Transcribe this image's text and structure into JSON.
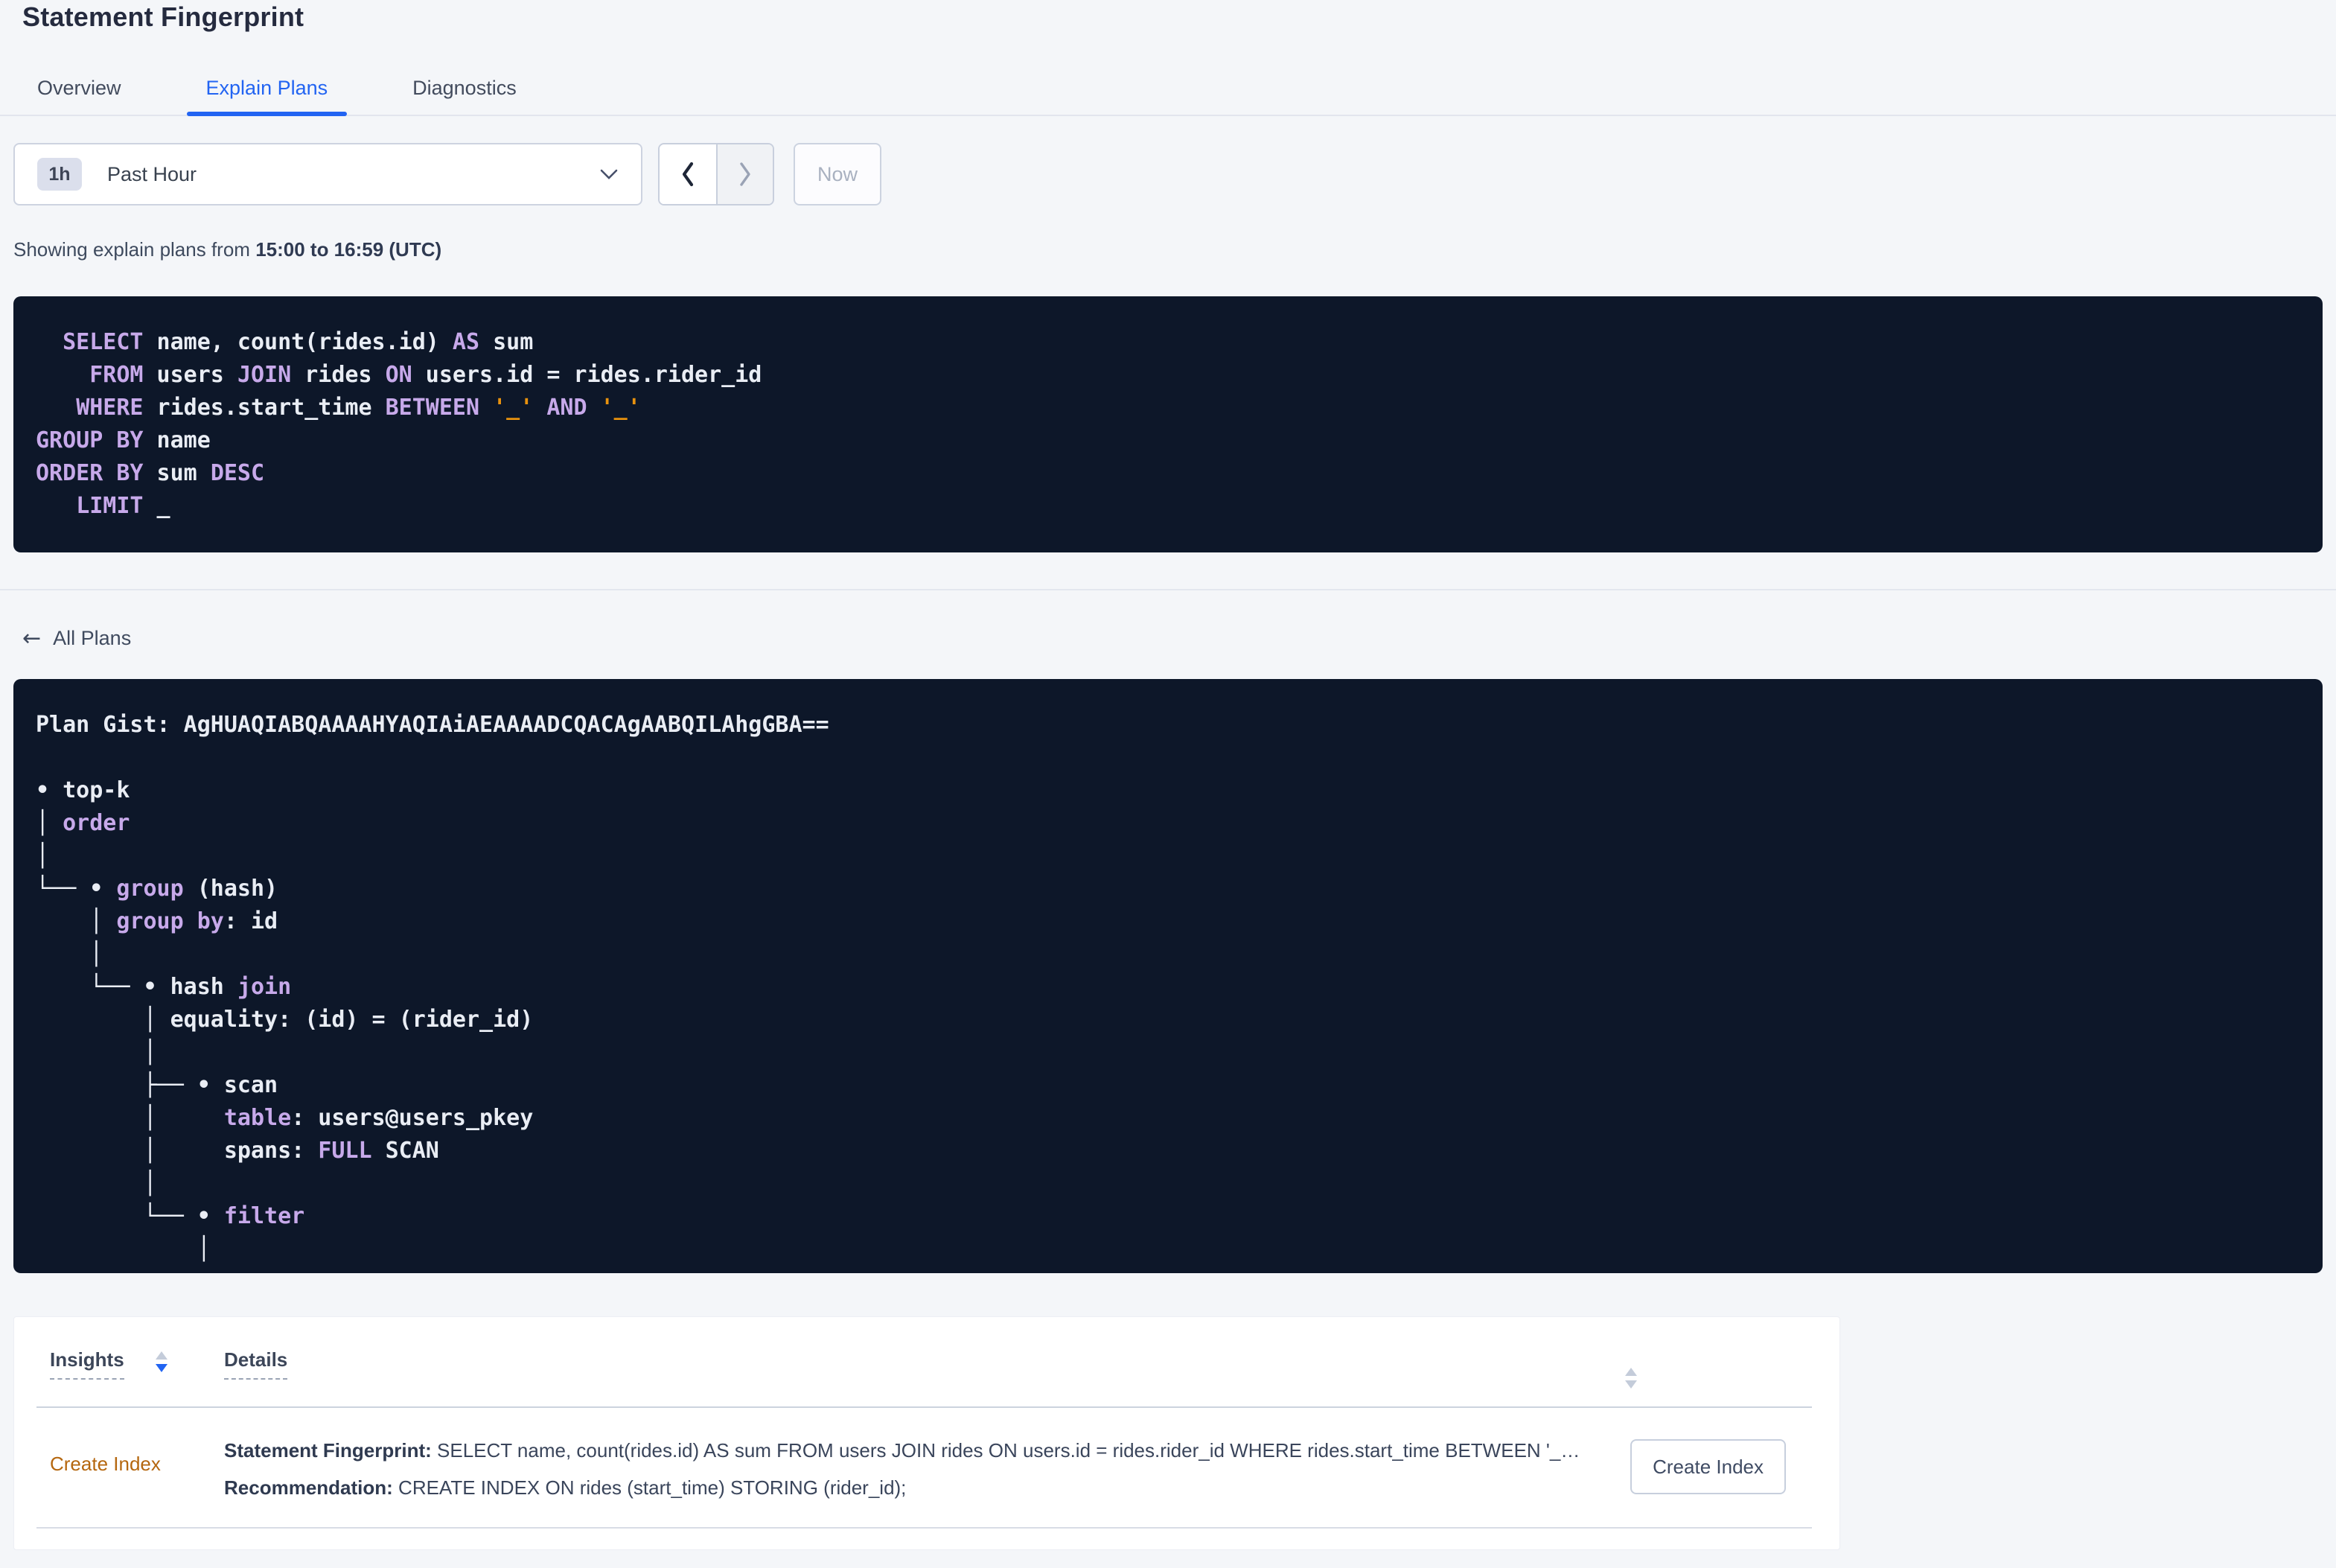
{
  "page": {
    "title": "Statement Fingerprint"
  },
  "tabs": [
    {
      "label": "Overview",
      "active": false
    },
    {
      "label": "Explain Plans",
      "active": true
    },
    {
      "label": "Diagnostics",
      "active": false
    }
  ],
  "time_picker": {
    "badge": "1h",
    "label": "Past Hour",
    "now_label": "Now"
  },
  "caption": {
    "prefix": "Showing explain plans from ",
    "range": "15:00 to 16:59 (UTC)"
  },
  "sql": {
    "lines": [
      [
        [
          "p",
          "  "
        ],
        [
          "k",
          "SELECT"
        ],
        [
          "p",
          " name, count(rides.id) "
        ],
        [
          "k",
          "AS"
        ],
        [
          "p",
          " sum"
        ]
      ],
      [
        [
          "p",
          "    "
        ],
        [
          "k",
          "FROM"
        ],
        [
          "p",
          " users "
        ],
        [
          "k",
          "JOIN"
        ],
        [
          "p",
          " rides "
        ],
        [
          "k",
          "ON"
        ],
        [
          "p",
          " users.id = rides.rider_id"
        ]
      ],
      [
        [
          "p",
          "   "
        ],
        [
          "k",
          "WHERE"
        ],
        [
          "p",
          " rides.start_time "
        ],
        [
          "k",
          "BETWEEN"
        ],
        [
          "p",
          " "
        ],
        [
          "l",
          "'_'"
        ],
        [
          "p",
          " "
        ],
        [
          "k",
          "AND"
        ],
        [
          "p",
          " "
        ],
        [
          "l",
          "'_'"
        ]
      ],
      [
        [
          "k",
          "GROUP BY"
        ],
        [
          "p",
          " name"
        ]
      ],
      [
        [
          "k",
          "ORDER BY"
        ],
        [
          "p",
          " sum "
        ],
        [
          "k",
          "DESC"
        ]
      ],
      [
        [
          "p",
          "   "
        ],
        [
          "k",
          "LIMIT"
        ],
        [
          "p",
          " _"
        ]
      ]
    ]
  },
  "back_link": {
    "arrow": "←",
    "label": "All Plans"
  },
  "plan": {
    "gist": "Plan Gist: AgHUAQIABQAAAAHYAQIAiAEAAAADCQACAgAABQILAhgGBA==",
    "tree": [
      [
        [
          "p",
          "• top-k"
        ]
      ],
      [
        [
          "p",
          "│ "
        ],
        [
          "k",
          "order"
        ]
      ],
      [
        [
          "p",
          "│"
        ]
      ],
      [
        [
          "p",
          "└── • "
        ],
        [
          "k",
          "group"
        ],
        [
          "p",
          " (hash)"
        ]
      ],
      [
        [
          "p",
          "    │ "
        ],
        [
          "k",
          "group by"
        ],
        [
          "p",
          ": id"
        ]
      ],
      [
        [
          "p",
          "    │"
        ]
      ],
      [
        [
          "p",
          "    └── • hash "
        ],
        [
          "k",
          "join"
        ]
      ],
      [
        [
          "p",
          "        │ equality: (id) = (rider_id)"
        ]
      ],
      [
        [
          "p",
          "        │"
        ]
      ],
      [
        [
          "p",
          "        ├── • scan"
        ]
      ],
      [
        [
          "p",
          "        │     "
        ],
        [
          "k",
          "table"
        ],
        [
          "p",
          ": users@users_pkey"
        ]
      ],
      [
        [
          "p",
          "        │     spans: "
        ],
        [
          "k",
          "FULL"
        ],
        [
          "p",
          " SCAN"
        ]
      ],
      [
        [
          "p",
          "        │"
        ]
      ],
      [
        [
          "p",
          "        └── • "
        ],
        [
          "k",
          "filter"
        ]
      ],
      [
        [
          "p",
          "            │"
        ]
      ]
    ]
  },
  "insights_table": {
    "columns": [
      {
        "label": "Insights"
      },
      {
        "label": "Details"
      }
    ],
    "rows": [
      {
        "insight": "Create Index",
        "details": [
          {
            "label": "Statement Fingerprint:",
            "text": " SELECT name, count(rides.id) AS sum FROM users JOIN rides ON users.id = rides.rider_id WHERE rides.start_time BETWEEN '_…"
          },
          {
            "label": "Recommendation:",
            "text": " CREATE INDEX ON rides (start_time) STORING (rider_id);"
          }
        ],
        "action_label": "Create Index"
      }
    ]
  },
  "colors": {
    "accent_blue": "#2264f2",
    "keyword_purple": "#c7a9ea",
    "literal_orange": "#e8920e",
    "code_background": "#0d1729",
    "code_text": "#e9edf4",
    "insight_link_orange": "#b5670f",
    "page_background": "#f4f6f9"
  }
}
